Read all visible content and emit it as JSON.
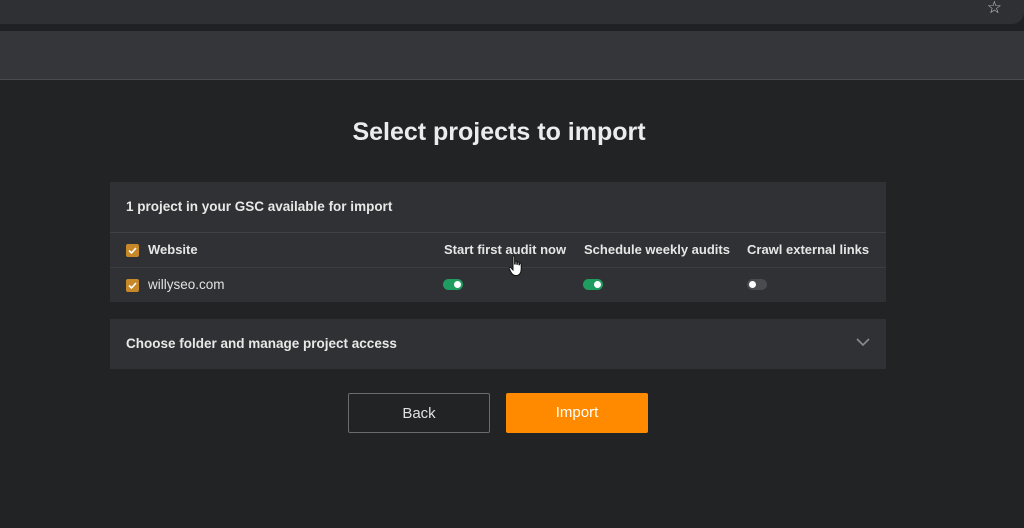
{
  "browser": {
    "star_icon": "star-icon"
  },
  "page": {
    "title": "Select projects to import"
  },
  "import_card": {
    "header": "1 project in your GSC available for import",
    "columns": {
      "website": "Website",
      "start_audit": "Start first audit now",
      "schedule": "Schedule weekly audits",
      "crawl": "Crawl external links"
    },
    "rows": [
      {
        "site": "willyseo.com",
        "checked": true,
        "start_audit": true,
        "schedule": true,
        "crawl": false
      }
    ]
  },
  "folder_card": {
    "label": "Choose folder and manage project access"
  },
  "buttons": {
    "back": "Back",
    "import": "Import"
  },
  "colors": {
    "accent": "#ff8a00",
    "checkbox": "#c7882a",
    "toggle_on": "#1f9d61",
    "toggle_off": "#4a4b4f"
  }
}
